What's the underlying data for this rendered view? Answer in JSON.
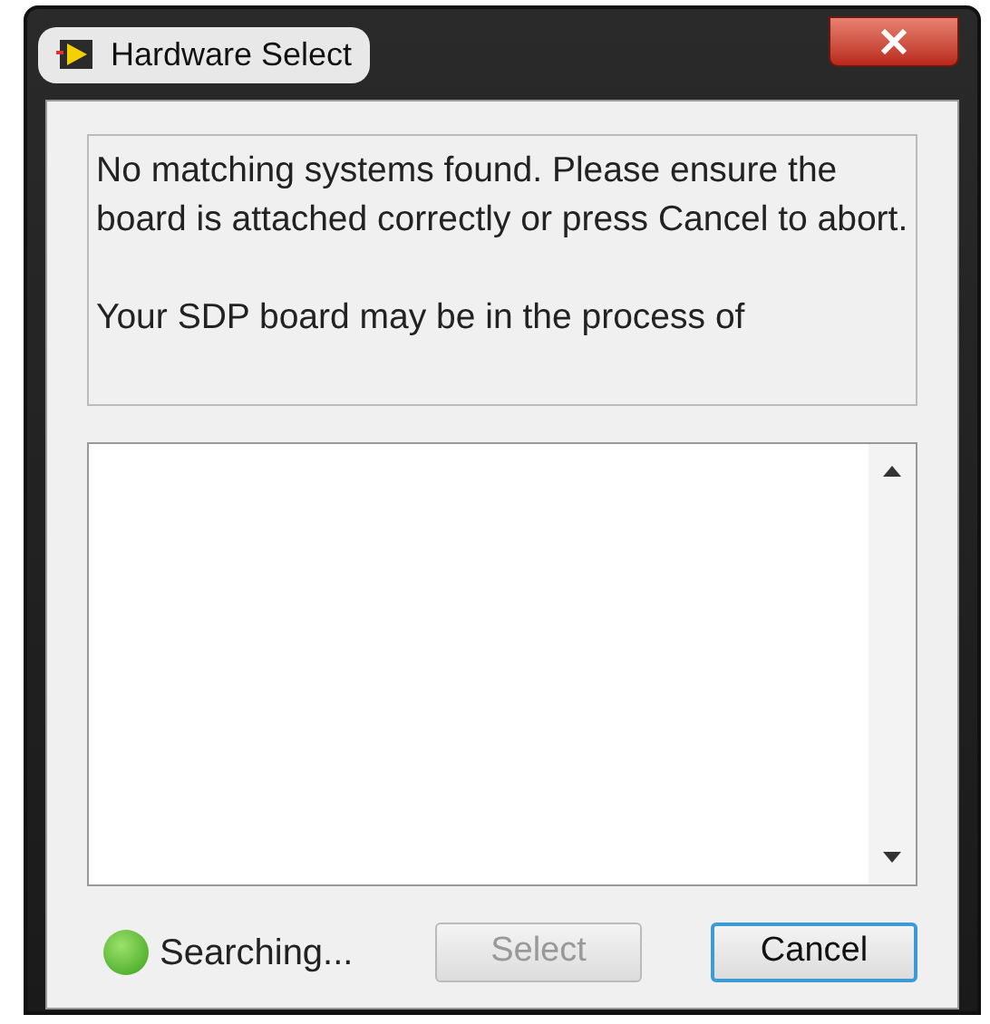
{
  "window": {
    "title": "Hardware Select"
  },
  "message": {
    "paragraphs": [
      "No matching systems found. Please ensure the board is attached correctly or press Cancel to abort.",
      "Your SDP board may be in the process of"
    ]
  },
  "status": {
    "label": "Searching...",
    "on": true
  },
  "buttons": [
    {
      "label": "Select",
      "disabled": true,
      "default": false
    },
    {
      "label": "Cancel",
      "disabled": false,
      "default": true
    }
  ]
}
